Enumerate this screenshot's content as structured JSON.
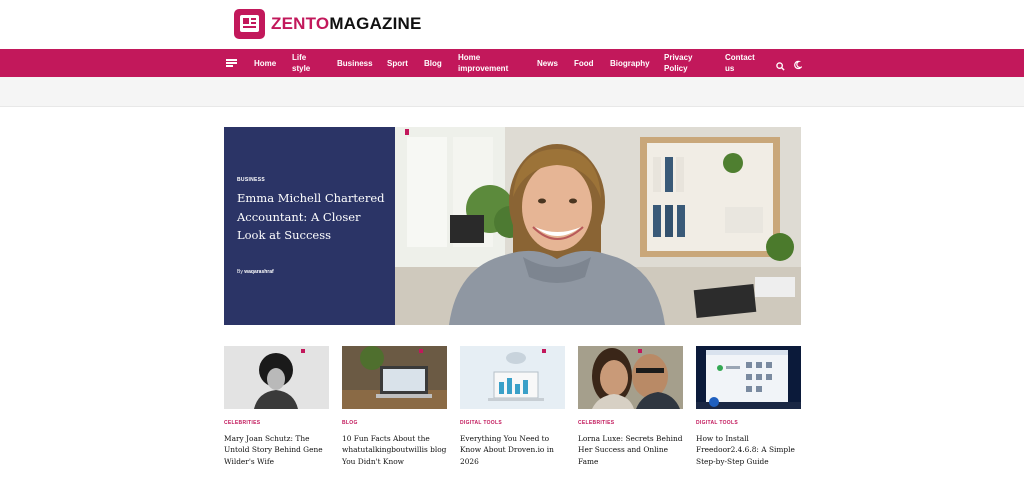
{
  "brand": {
    "logo_part1": "ZENTO",
    "logo_part2": "MAGAZINE",
    "accent": "#c2185b",
    "navy": "#2b3466"
  },
  "nav": {
    "items": [
      "Home",
      "Life style",
      "Business",
      "Sport",
      "Blog",
      "Home improvement",
      "News",
      "Food",
      "Biography",
      "Privacy Policy",
      "Contact us"
    ],
    "icons": [
      "menu-icon",
      "search-icon",
      "moon-icon"
    ]
  },
  "hero": {
    "category": "BUSINESS",
    "title": "Emma Michell Chartered Accountant: A Closer Look at Success",
    "by_label": "By",
    "author": "waqarashraf"
  },
  "cards": [
    {
      "category": "CELEBRITIES",
      "title": "Mary Joan Schutz: The Untold Story Behind Gene Wilder's Wife"
    },
    {
      "category": "BLOG",
      "title": "10 Fun Facts About the whatutalkingboutwillis blog You Didn't Know"
    },
    {
      "category": "DIGITAL TOOLS",
      "title": "Everything You Need to Know About Droven.io in 2026"
    },
    {
      "category": "CELEBRITIES",
      "title": "Lorna Luxe: Secrets Behind Her Success and Online Fame"
    },
    {
      "category": "DIGITAL TOOLS",
      "title": "How to Install Freedoor2.4.6.8: A Simple Step-by-Step Guide"
    }
  ]
}
